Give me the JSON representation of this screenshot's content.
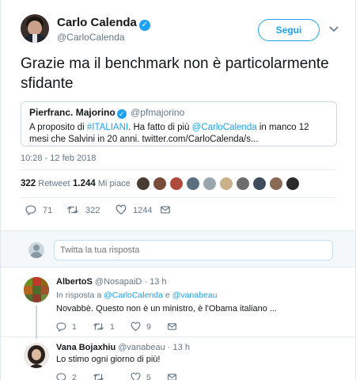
{
  "tweet": {
    "author_name": "Carlo Calenda",
    "author_handle": "@CarloCalenda",
    "follow_label": "Segui",
    "text": "Grazie ma il benchmark non è particolarmente sfidante",
    "timestamp": "10:28 - 12 feb 2018",
    "quote": {
      "name": "Pierfranc. Majorino",
      "handle": "@pfmajorino",
      "text_before": "A proposito di ",
      "hashtag": "#ITALIANI",
      "text_middle": ". Ha fatto di più ",
      "mention": "@CarloCalenda",
      "text_after": " in manco 12 mesi che Salvini in 20 anni. twitter.com/CarloCalenda/s..."
    },
    "stats": {
      "retweets_count": "322",
      "retweets_label": "Retweet",
      "likes_count": "1.244",
      "likes_label": "Mi piace"
    },
    "actions": {
      "replies": "71",
      "retweets": "322",
      "likes": "1244"
    },
    "likers_colors": [
      "#4a3c35",
      "#7a4a3a",
      "#b04a3c",
      "#5c6f7e",
      "#9aa5ad",
      "#c9b28a",
      "#6d6d6d",
      "#3e4c5c",
      "#8a6a55",
      "#2b2b2b"
    ]
  },
  "reply_box": {
    "placeholder": "Twitta la tua risposta"
  },
  "replies": [
    {
      "name": "AlbertoS",
      "handle": "@NosapaiD",
      "time": "· 13 h",
      "in_reply_prefix": "In risposta a ",
      "in_reply_user1": "@CarloCalenda",
      "in_reply_join": " e ",
      "in_reply_user2": "@vanabeau",
      "text": "Novabbè. Questo non è un ministro, è l'Obama italiano ...",
      "reply_count": "1",
      "retweet_count": "1",
      "like_count": "9"
    },
    {
      "name": "Vana Bojaxhiu",
      "handle": "@vanabeau",
      "time": "· 13 h",
      "text": "Lo stimo ogni giorno di più!",
      "reply_count": "2",
      "retweet_count": "",
      "like_count": "5"
    }
  ],
  "colors": {
    "accent": "#1da1f2",
    "muted": "#657786"
  }
}
